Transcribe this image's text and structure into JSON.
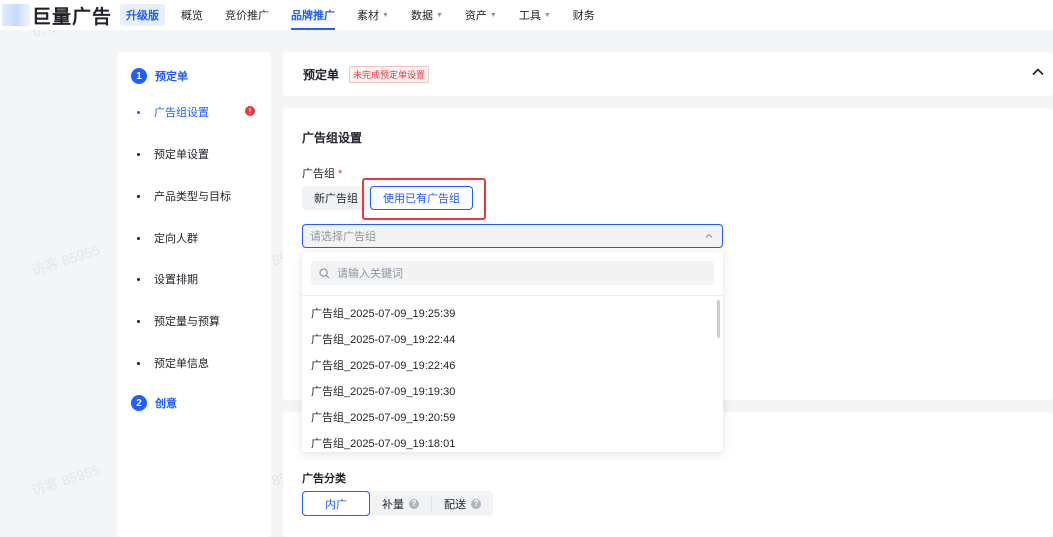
{
  "topbar": {
    "brand": "巨量广告",
    "edition_badge": "升级版",
    "nav": [
      {
        "label": "概览",
        "caret": false,
        "active": false
      },
      {
        "label": "竞价推广",
        "caret": false,
        "active": false
      },
      {
        "label": "品牌推广",
        "caret": false,
        "active": true
      },
      {
        "label": "素材",
        "caret": true,
        "active": false
      },
      {
        "label": "数据",
        "caret": true,
        "active": false
      },
      {
        "label": "资产",
        "caret": true,
        "active": false
      },
      {
        "label": "工具",
        "caret": true,
        "active": false
      },
      {
        "label": "财务",
        "caret": false,
        "active": false
      }
    ]
  },
  "steps": {
    "step1": {
      "num": "1",
      "title": "预定单"
    },
    "items": [
      "广告组设置",
      "预定单设置",
      "产品类型与目标",
      "定向人群",
      "设置排期",
      "预定量与预算",
      "预定单信息"
    ],
    "warn_glyph": "!",
    "step2": {
      "num": "2",
      "title": "创意"
    }
  },
  "order_card": {
    "title": "预定单",
    "status": "未完成预定单设置"
  },
  "adgroup": {
    "section_title": "广告组设置",
    "field_label": "广告组",
    "required_mark": "*",
    "mode_new": "新广告组",
    "mode_existing": "使用已有广告组",
    "select_placeholder": "请选择广告组",
    "search_placeholder": "请输入关键词",
    "options": [
      "广告组_2025-07-09_19:25:39",
      "广告组_2025-07-09_19:22:44",
      "广告组_2025-07-09_19:22:46",
      "广告组_2025-07-09_19:19:30",
      "广告组_2025-07-09_19:20:59",
      "广告组_2025-07-09_19:18:01"
    ]
  },
  "category": {
    "label": "广告分类",
    "options": [
      "内广",
      "补量",
      "配送"
    ],
    "help_glyph": "?"
  },
  "watermark": "访客 85955",
  "colors": {
    "accent": "#1f5eff",
    "danger": "#e5393b",
    "background": "#f4f5f7"
  }
}
